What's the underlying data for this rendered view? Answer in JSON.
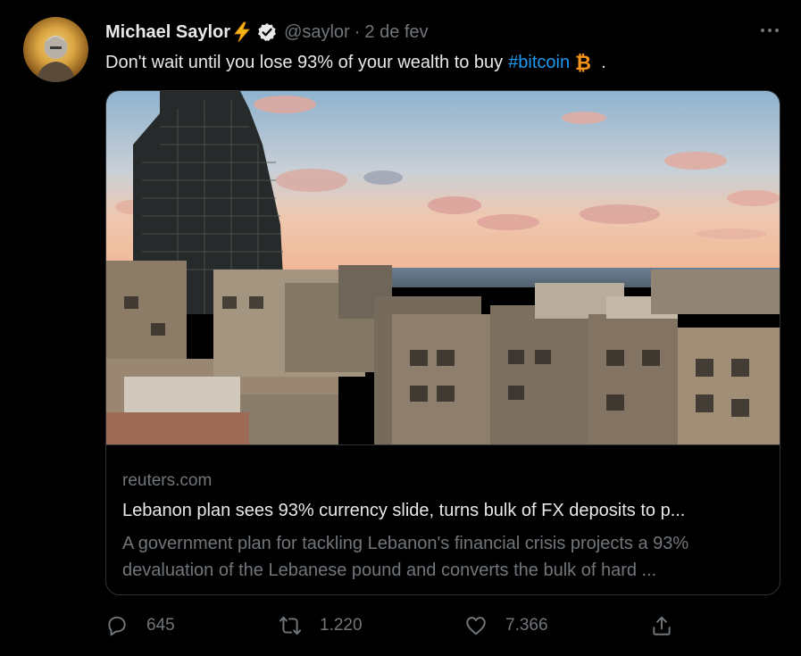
{
  "author": {
    "name": "Michael Saylor",
    "handle": "@saylor",
    "separator": "·",
    "date": "2 de fev"
  },
  "tweet": {
    "text_before": "Don't wait until you lose 93% of your wealth to buy",
    "hashtag": "#bitcoin",
    "text_after": "."
  },
  "card": {
    "domain": "reuters.com",
    "headline": "Lebanon plan sees 93% currency slide, turns bulk of FX deposits to p...",
    "description": "A government plan for tackling Lebanon's financial crisis projects a 93% devaluation of the Lebanese pound and converts the bulk of hard ..."
  },
  "actions": {
    "replies": "645",
    "retweets": "1.220",
    "likes": "7.366"
  },
  "icons": {
    "name_emoji": "lightning-emoji-icon",
    "verified": "verified-badge-icon",
    "hashtag_emoji": "bitcoin-emoji-icon",
    "more": "more-options-icon",
    "reply": "reply-icon",
    "retweet": "retweet-icon",
    "like": "heart-icon",
    "share": "share-icon"
  },
  "colors": {
    "background": "#000000",
    "text": "#e7e9ea",
    "muted": "#71767b",
    "link": "#1d9bf0",
    "border": "#2f3336",
    "bitcoin": "#f7931a"
  }
}
